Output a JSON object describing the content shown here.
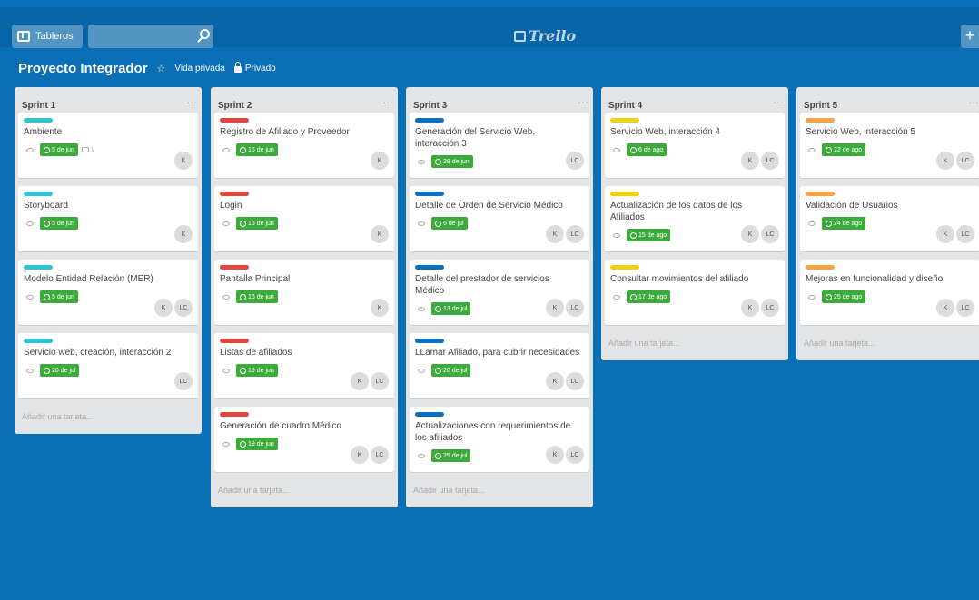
{
  "topbar": {
    "boards_label": "Tableros",
    "search_value": "",
    "logo_text": "Trello",
    "add_label": "+"
  },
  "board": {
    "title": "Proyecto Integrador",
    "visibility_label": "Vida privada",
    "team_label": "Privado"
  },
  "colors": {
    "background": "#0a6fb4",
    "teal": "#2ec4d6",
    "red": "#e0483e",
    "blue": "#0870c1",
    "yellow": "#efd20f",
    "orange": "#f6a343",
    "due_green": "#3cab3c"
  },
  "icons": [
    "board-icon",
    "search-icon",
    "star-icon",
    "globe-icon",
    "lock-icon",
    "eye-icon",
    "clock-icon",
    "comment-icon"
  ],
  "lists": [
    {
      "title": "Sprint 1",
      "add_label": "Añadir una tarjeta...",
      "cards": [
        {
          "label_color": "#2ec4d6",
          "title": "Ambiente",
          "due": "5 de jun",
          "comments": "1",
          "members": [
            "K"
          ]
        },
        {
          "label_color": "#2ec4d6",
          "title": "Storyboard",
          "due": "5 de jun",
          "members": [
            "K"
          ]
        },
        {
          "label_color": "#2ec4d6",
          "title": "Modelo Entidad Relación (MER)",
          "due": "5 de jun",
          "members": [
            "K",
            "LC"
          ]
        },
        {
          "label_color": "#2ec4d6",
          "title": "Servicio web, creación, interacción 2",
          "due": "20 de jul",
          "members": [
            "LC"
          ]
        }
      ]
    },
    {
      "title": "Sprint 2",
      "add_label": "Añadir una tarjeta...",
      "cards": [
        {
          "label_color": "#e0483e",
          "title": "Registro de Afiliado y Proveedor",
          "due": "16 de jun",
          "members": [
            "K"
          ]
        },
        {
          "label_color": "#e0483e",
          "title": "Login",
          "due": "16 de jun",
          "members": [
            "K"
          ]
        },
        {
          "label_color": "#e0483e",
          "title": "Pantalla Principal",
          "due": "16 de jun",
          "members": [
            "K"
          ]
        },
        {
          "label_color": "#e0483e",
          "title": "Listas de afiliados",
          "due": "19 de jun",
          "members": [
            "K",
            "LC"
          ]
        },
        {
          "label_color": "#e0483e",
          "title": "Generación de cuadro Médico",
          "due": "19 de jun",
          "members": [
            "K",
            "LC"
          ]
        }
      ]
    },
    {
      "title": "Sprint 3",
      "add_label": "Añadir una tarjeta...",
      "cards": [
        {
          "label_color": "#0870c1",
          "title": "Generación del Servicio Web, interacción 3",
          "due": "28 de jun",
          "members": [
            "LC"
          ]
        },
        {
          "label_color": "#0870c1",
          "title": "Detalle de Orden de Servicio Médico",
          "due": "6 de jul",
          "members": [
            "K",
            "LC"
          ]
        },
        {
          "label_color": "#0870c1",
          "title": "Detalle del prestador de servicios Médico",
          "due": "13 de jul",
          "members": [
            "K",
            "LC"
          ]
        },
        {
          "label_color": "#0870c1",
          "title": "LLamar Afiliado, para cubrir necesidades",
          "due": "20 de jul",
          "members": [
            "K",
            "LC"
          ]
        },
        {
          "label_color": "#0870c1",
          "title": "Actualizaciones con requerimientos de los afiliados",
          "due": "25 de jul",
          "members": [
            "K",
            "LC"
          ]
        }
      ]
    },
    {
      "title": "Sprint 4",
      "add_label": "Añadir una tarjeta...",
      "cards": [
        {
          "label_color": "#efd20f",
          "title": "Servicio Web, interacción 4",
          "due": "6 de ago",
          "members": [
            "K",
            "LC"
          ]
        },
        {
          "label_color": "#efd20f",
          "title": "Actualización de los datos de los Afiliados",
          "due": "15 de ago",
          "members": [
            "K",
            "LC"
          ]
        },
        {
          "label_color": "#efd20f",
          "title": "Consultar movimientos del afiliado",
          "due": "17 de ago",
          "members": [
            "K",
            "LC"
          ]
        }
      ]
    },
    {
      "title": "Sprint 5",
      "add_label": "Añadir una tarjeta...",
      "cards": [
        {
          "label_color": "#f6a343",
          "title": "Servicio Web, interacción 5",
          "due": "22 de ago",
          "members": [
            "K",
            "LC"
          ]
        },
        {
          "label_color": "#f6a343",
          "title": "Validación de Usuarios",
          "due": "24 de ago",
          "members": [
            "K",
            "LC"
          ]
        },
        {
          "label_color": "#f6a343",
          "title": "Mejoras en funcionalidad y diseño",
          "due": "25 de ago",
          "members": [
            "K",
            "LC"
          ]
        }
      ]
    }
  ]
}
